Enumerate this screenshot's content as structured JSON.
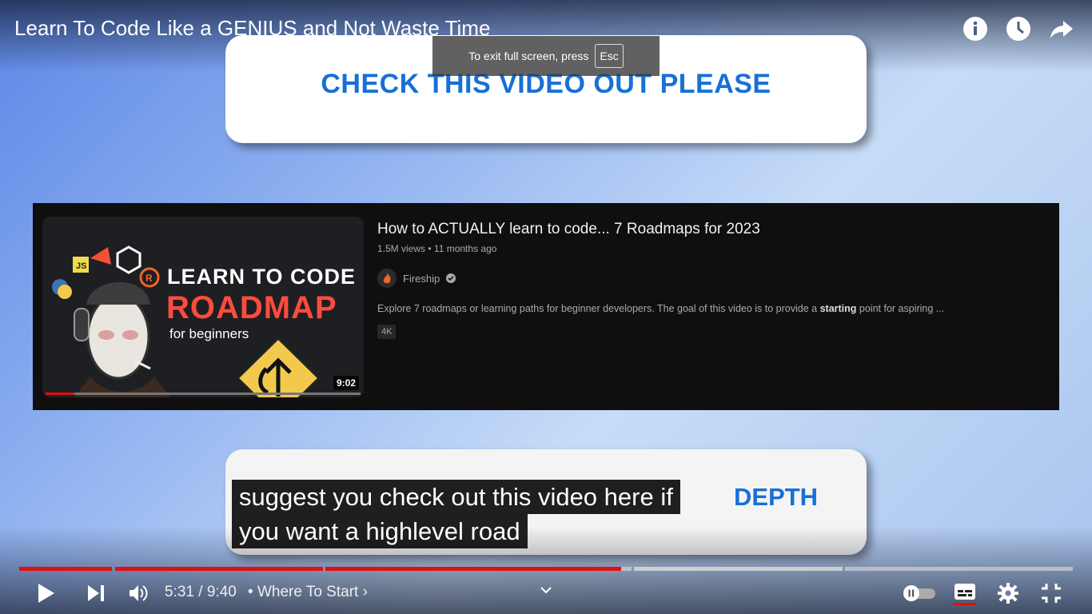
{
  "player": {
    "title": "Learn To Code Like a GENIUS and Not Waste Time",
    "fullscreen_toast": {
      "text": "To exit full screen, press",
      "key": "Esc"
    },
    "time_current": "5:31",
    "time_separator": "/",
    "time_total": "9:40",
    "chapter_bullet": "•",
    "chapter_title": "Where To Start",
    "chapter_arrow": "›",
    "progress_fraction": 0.583,
    "accent_color": "#e01010"
  },
  "top_icons": [
    "info-icon",
    "watch-later-icon",
    "share-icon"
  ],
  "video_content": {
    "top_banner": "CHECK THIS VIDEO OUT PLEASE",
    "bottom_banner": "DEPTH",
    "recommended": {
      "title": "How to ACTUALLY learn to code... 7 Roadmaps for 2023",
      "views": "1.5M views",
      "dot": "•",
      "age": "11 months ago",
      "channel": "Fireship",
      "description_start": "Explore 7 roadmaps or learning paths for beginner developers. The goal of this video is to provide a ",
      "description_bold": "starting",
      "description_end": " point for aspiring ...",
      "badge": "4K",
      "thumbnail": {
        "line1": "LEARN TO CODE",
        "line2": "ROADMAP",
        "line3": "for beginners",
        "logos": [
          "JS",
          "R"
        ],
        "duration": "9:02"
      }
    }
  },
  "captions": [
    "suggest you check out this video here if",
    "you want a highlevel road"
  ]
}
